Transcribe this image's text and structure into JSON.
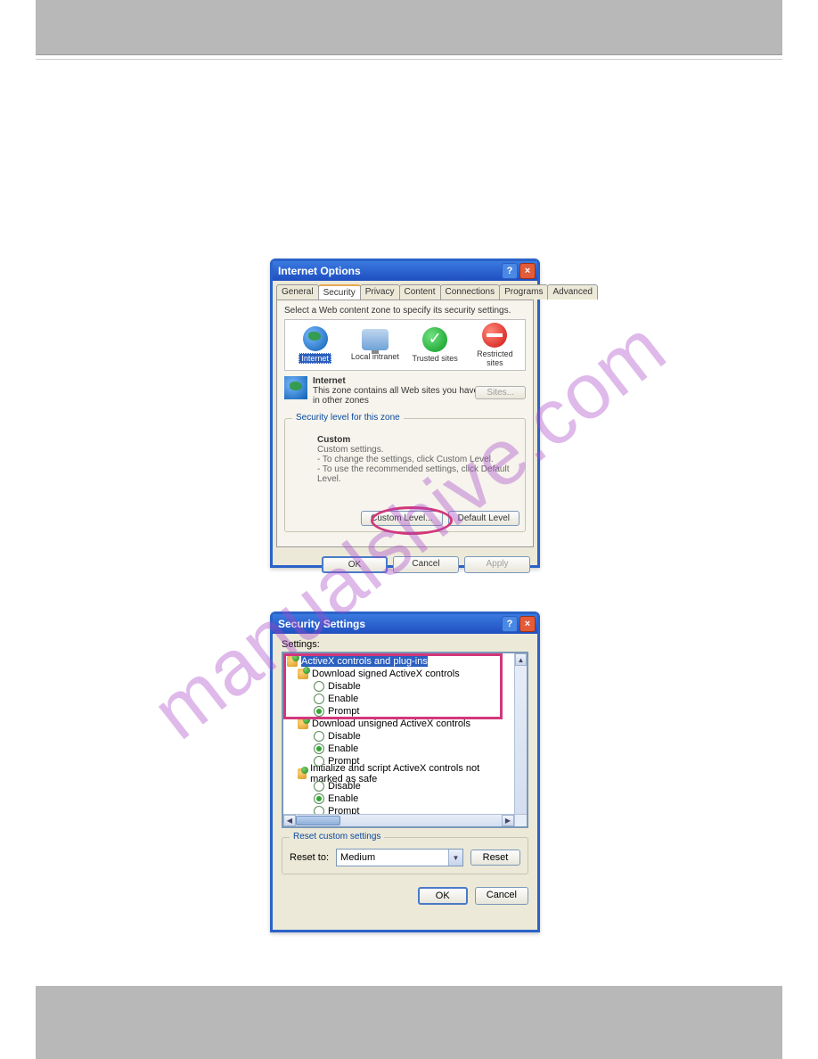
{
  "watermark": "manualshive.com",
  "dlg1": {
    "title": "Internet Options",
    "tabs": [
      "General",
      "Security",
      "Privacy",
      "Content",
      "Connections",
      "Programs",
      "Advanced"
    ],
    "active_tab": "Security",
    "instruction": "Select a Web content zone to specify its security settings.",
    "zones": {
      "internet": "Internet",
      "intranet": "Local intranet",
      "trusted": "Trusted sites",
      "restricted": "Restricted sites"
    },
    "zone_heading": "Internet",
    "zone_desc": "This zone contains all Web sites you haven't placed in other zones",
    "sites_btn": "Sites...",
    "group_title": "Security level for this zone",
    "custom_label": "Custom",
    "custom_line1": "Custom settings.",
    "custom_line2": "- To change the settings, click Custom Level.",
    "custom_line3": "- To use the recommended settings, click Default Level.",
    "custom_level_btn": "Custom Level...",
    "default_level_btn": "Default Level",
    "ok": "OK",
    "cancel": "Cancel",
    "apply": "Apply"
  },
  "dlg2": {
    "title": "Security Settings",
    "settings_label": "Settings:",
    "tree": {
      "cat": "ActiveX controls and plug-ins",
      "g1": {
        "label": "Download signed ActiveX controls",
        "disable": "Disable",
        "enable": "Enable",
        "prompt": "Prompt"
      },
      "g2": {
        "label": "Download unsigned ActiveX controls",
        "disable": "Disable",
        "enable": "Enable",
        "prompt": "Prompt"
      },
      "g3": {
        "label": "Initialize and script ActiveX controls not marked as safe",
        "disable": "Disable",
        "enable": "Enable",
        "prompt": "Prompt"
      }
    },
    "reset_group": "Reset custom settings",
    "reset_to": "Reset to:",
    "reset_value": "Medium",
    "reset_btn": "Reset",
    "ok": "OK",
    "cancel": "Cancel"
  }
}
